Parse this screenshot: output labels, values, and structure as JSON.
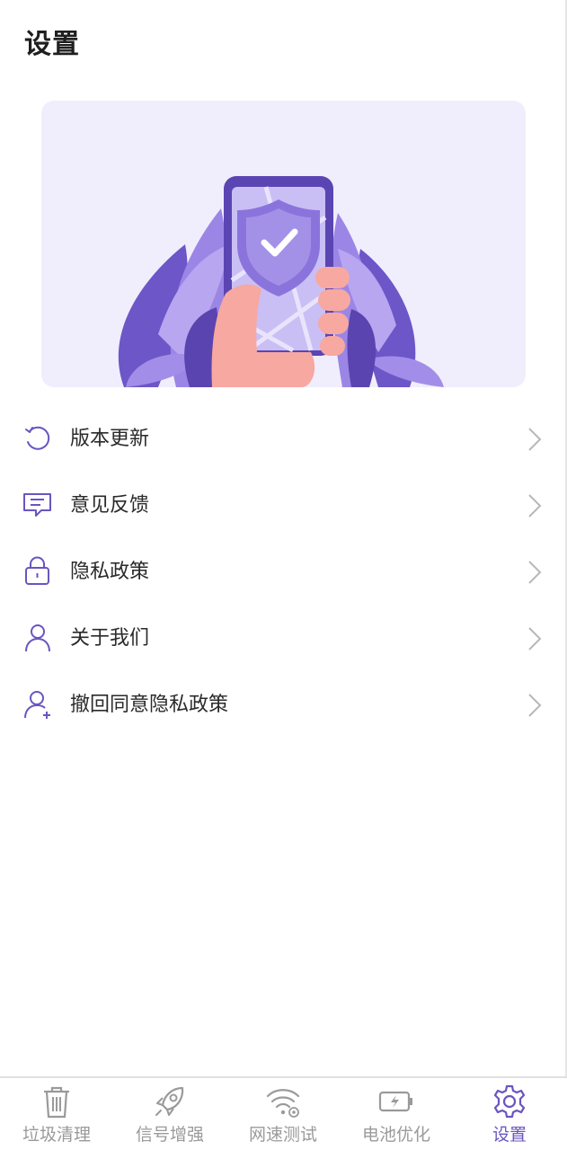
{
  "header": {
    "title": "设置"
  },
  "menu": {
    "items": [
      {
        "label": "版本更新",
        "icon": "refresh-icon"
      },
      {
        "label": "意见反馈",
        "icon": "feedback-icon"
      },
      {
        "label": "隐私政策",
        "icon": "lock-icon"
      },
      {
        "label": "关于我们",
        "icon": "user-icon"
      },
      {
        "label": "撤回同意隐私政策",
        "icon": "user-plus-icon"
      }
    ]
  },
  "tabbar": {
    "tabs": [
      {
        "label": "垃圾清理",
        "icon": "trash-icon",
        "active": false
      },
      {
        "label": "信号增强",
        "icon": "rocket-icon",
        "active": false
      },
      {
        "label": "网速测试",
        "icon": "wifi-icon",
        "active": false
      },
      {
        "label": "电池优化",
        "icon": "battery-icon",
        "active": false
      },
      {
        "label": "设置",
        "icon": "gear-icon",
        "active": true
      }
    ]
  },
  "colors": {
    "accent": "#6a55c0",
    "icon_inactive": "#9a9a9a",
    "banner_bg": "#f0eefc"
  }
}
